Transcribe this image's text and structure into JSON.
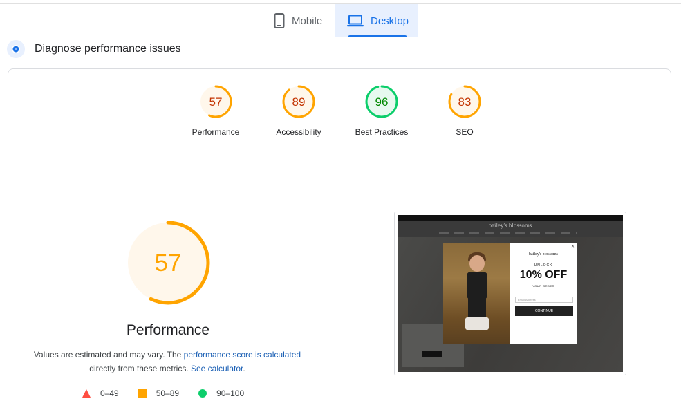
{
  "device_tabs": {
    "mobile": {
      "label": "Mobile",
      "icon": "smartphone-icon"
    },
    "desktop": {
      "label": "Desktop",
      "icon": "laptop-icon",
      "selected": true
    }
  },
  "diagnose": {
    "title": "Diagnose performance issues",
    "icon": "lighthouse-icon"
  },
  "colors": {
    "average": "#ffa400",
    "good": "#0cce6b",
    "poor": "#ff4e42",
    "link": "#1a5fb4",
    "tab_active": "#1a73e8"
  },
  "scores": [
    {
      "label": "Performance",
      "value": "57",
      "fraction": 0.57,
      "status": "average"
    },
    {
      "label": "Accessibility",
      "value": "89",
      "fraction": 0.89,
      "status": "average"
    },
    {
      "label": "Best Practices",
      "value": "96",
      "fraction": 0.96,
      "status": "good"
    },
    {
      "label": "SEO",
      "value": "83",
      "fraction": 0.83,
      "status": "average"
    }
  ],
  "performance": {
    "value": "57",
    "fraction": 0.57,
    "title": "Performance",
    "note_prefix": "Values are estimated and may vary. The ",
    "note_link": "performance score is calculated",
    "note_middle": " directly from these metrics. ",
    "note_calc": "See calculator",
    "note_end": "."
  },
  "legend": [
    {
      "range": "0–49",
      "shape": "triangle",
      "status": "poor"
    },
    {
      "range": "50–89",
      "shape": "square",
      "status": "average"
    },
    {
      "range": "90–100",
      "shape": "circle",
      "status": "good"
    }
  ],
  "screenshot": {
    "brand": "bailey's blossoms",
    "unlock": "UNLOCK",
    "offer": "10% OFF",
    "order": "YOUR ORDER",
    "email_placeholder": "Email Address",
    "continue": "CONTINUE"
  }
}
